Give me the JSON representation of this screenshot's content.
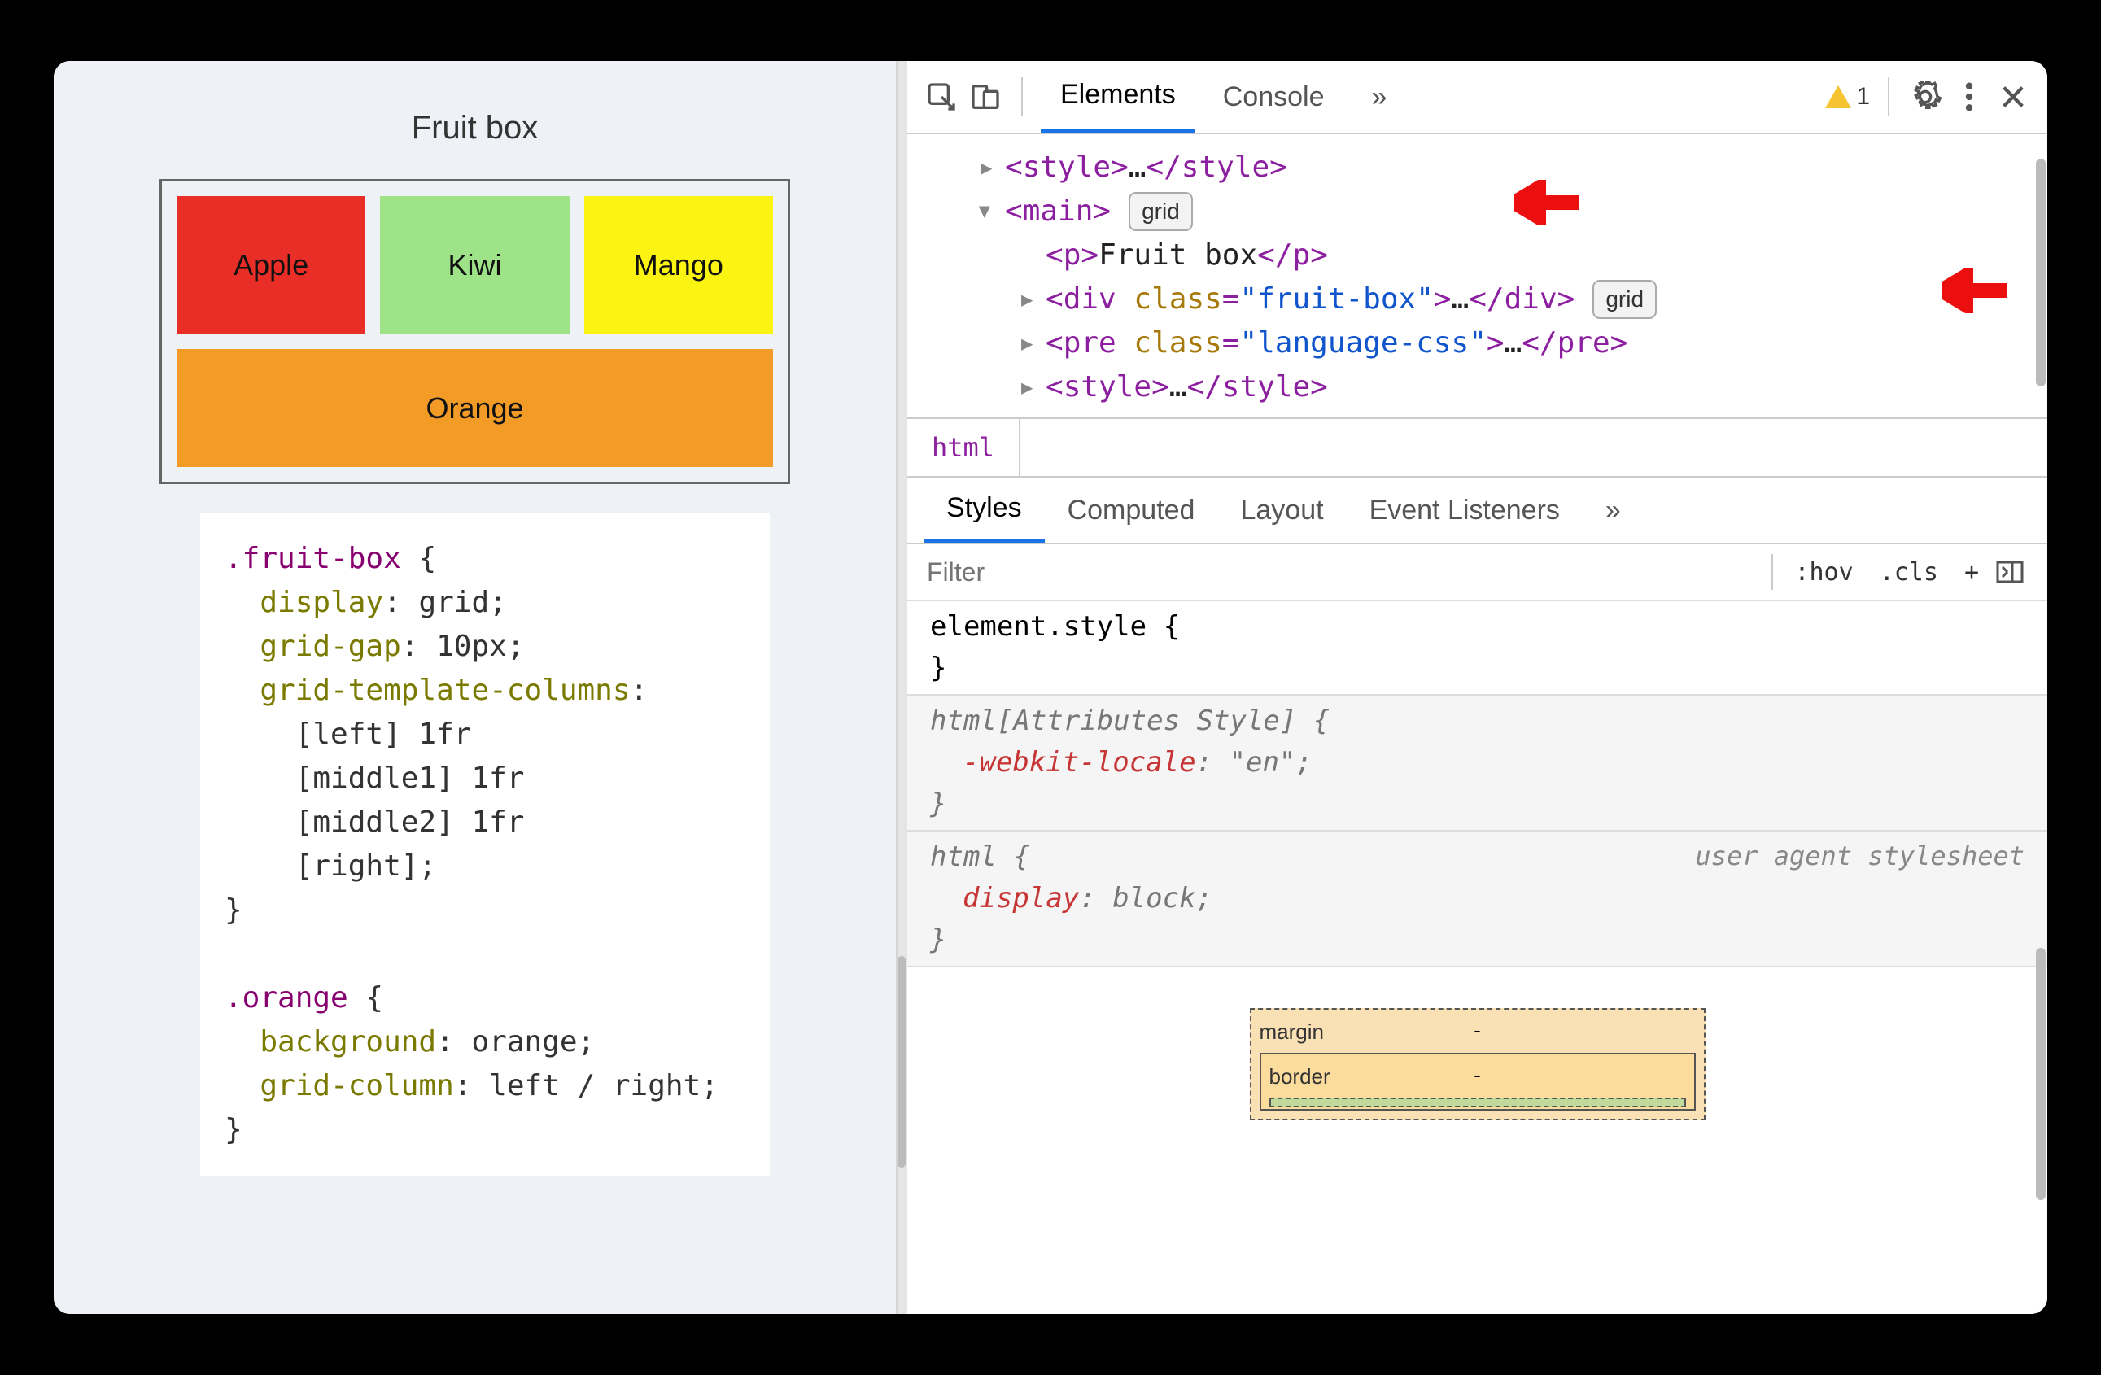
{
  "preview": {
    "title": "Fruit box",
    "fruits": {
      "apple": "Apple",
      "kiwi": "Kiwi",
      "mango": "Mango",
      "orange": "Orange"
    },
    "code": ".fruit-box {\n  display: grid;\n  grid-gap: 10px;\n  grid-template-columns:\n    [left] 1fr\n    [middle1] 1fr\n    [middle2] 1fr\n    [right];\n}\n\n.orange {\n  background: orange;\n  grid-column: left / right;\n}"
  },
  "devtools": {
    "tabs": {
      "elements": "Elements",
      "console": "Console",
      "more": "»"
    },
    "warning_count": "1",
    "dom": {
      "style1_open": "<style>",
      "style_ellipsis": "…",
      "style1_close": "</style>",
      "main_open": "<main>",
      "grid_badge": "grid",
      "p_open": "<p>",
      "p_text": "Fruit box",
      "p_close": "</p>",
      "div_open": "<div ",
      "class_attr": "class",
      "eq": "=",
      "fruit_box_val": "\"fruit-box\"",
      "div_end": ">",
      "div_close": "</div>",
      "pre_open": "<pre ",
      "lang_css_val": "\"language-css\"",
      "pre_close": "</pre>",
      "style2_open": "<style>",
      "style2_close": "</style>"
    },
    "breadcrumb": "html",
    "styles_tabs": {
      "styles": "Styles",
      "computed": "Computed",
      "layout": "Layout",
      "listeners": "Event Listeners",
      "more": "»"
    },
    "filter": {
      "placeholder": "Filter",
      "hov": ":hov",
      "cls": ".cls",
      "plus": "+"
    },
    "rules": {
      "element_style": "element.style {",
      "close": "}",
      "html_attr": "html[Attributes Style] {",
      "webkit_locale_prop": "-webkit-locale",
      "webkit_locale_val": ": \"en\";",
      "html_sel": "html {",
      "user_agent": "user agent stylesheet",
      "display_prop": "display",
      "display_val": ": block;"
    },
    "box_model": {
      "margin": "margin",
      "border": "border",
      "dash": "-"
    }
  }
}
